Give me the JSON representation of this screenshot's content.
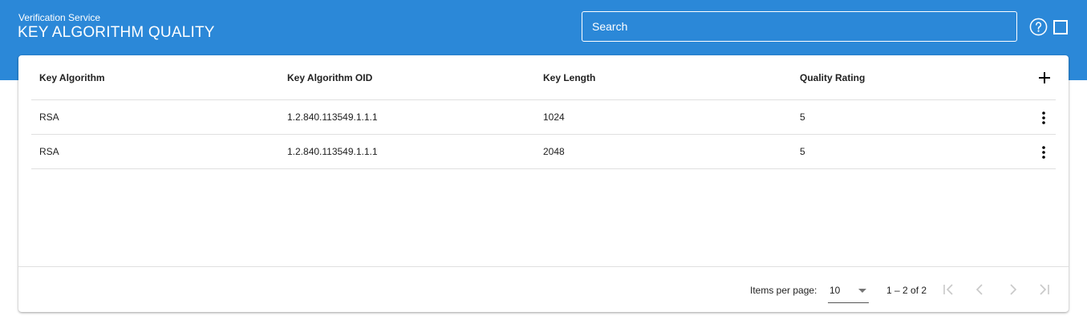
{
  "header": {
    "service_name": "Verification Service",
    "title": "KEY ALGORITHM QUALITY",
    "search_placeholder": "Search",
    "icons": [
      "help-icon",
      "square-icon"
    ],
    "background_color": "#2b88d8"
  },
  "table": {
    "columns": [
      "Key Algorithm",
      "Key Algorithm OID",
      "Key Length",
      "Quality Rating"
    ],
    "rows": [
      [
        "RSA",
        "1.2.840.113549.1.1.1",
        "1024",
        "5"
      ],
      [
        "RSA",
        "1.2.840.113549.1.1.1",
        "2048",
        "5"
      ]
    ],
    "add_icon": "plus-icon",
    "row_menu_icon": "more-vert-icon"
  },
  "paginator": {
    "items_per_page_label": "Items per page:",
    "items_per_page_value": "10",
    "range_label": "1 – 2 of 2"
  }
}
